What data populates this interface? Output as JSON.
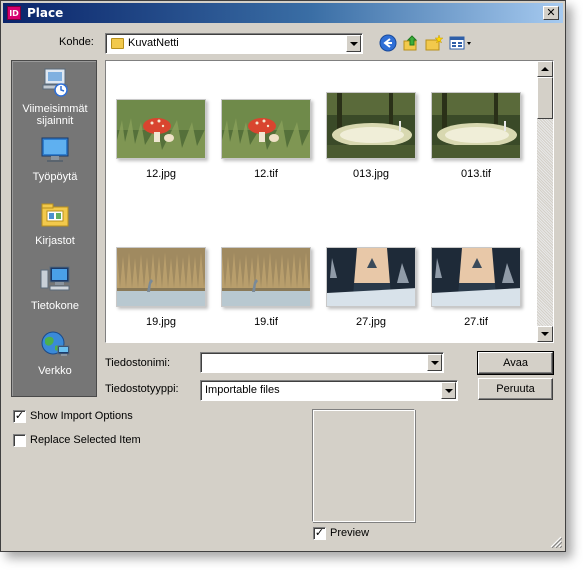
{
  "window": {
    "title": "Place",
    "app_badge": "ID",
    "close_glyph": "✕"
  },
  "lookin": {
    "label": "Kohde:",
    "value": "KuvatNetti",
    "folder_icon": "folder-icon"
  },
  "toolbar": {
    "back_icon": "back-arrow-icon",
    "up_icon": "up-folder-icon",
    "new_folder_icon": "new-folder-icon",
    "view_icon": "view-menu-icon"
  },
  "places": [
    {
      "label": "Viimeisimmät sijainnit",
      "icon": "recent-places-icon"
    },
    {
      "label": "Työpöytä",
      "icon": "desktop-icon"
    },
    {
      "label": "Kirjastot",
      "icon": "libraries-icon"
    },
    {
      "label": "Tietokone",
      "icon": "computer-icon"
    },
    {
      "label": "Verkko",
      "icon": "network-icon"
    }
  ],
  "files": [
    {
      "name": "12.jpg",
      "image": "mushroom-photo"
    },
    {
      "name": "12.tif",
      "image": "mushroom-photo"
    },
    {
      "name": "013.jpg",
      "image": "forest-pond-photo"
    },
    {
      "name": "013.tif",
      "image": "forest-pond-photo"
    },
    {
      "name": "19.jpg",
      "image": "heron-reeds-photo"
    },
    {
      "name": "19.tif",
      "image": "heron-reeds-photo"
    },
    {
      "name": "27.jpg",
      "image": "winter-forest-photo"
    },
    {
      "name": "27.tif",
      "image": "winter-forest-photo"
    }
  ],
  "filename": {
    "label": "Tiedostonimi:",
    "value": ""
  },
  "filetype": {
    "label": "Tiedostotyyppi:",
    "value": "Importable files"
  },
  "buttons": {
    "open": "Avaa",
    "cancel": "Peruuta"
  },
  "options": {
    "show_import": {
      "label": "Show Import Options",
      "checked": true
    },
    "replace_selected": {
      "label": "Replace Selected Item",
      "checked": false
    },
    "preview": {
      "label": "Preview",
      "checked": true
    }
  },
  "check_glyph": "✓"
}
